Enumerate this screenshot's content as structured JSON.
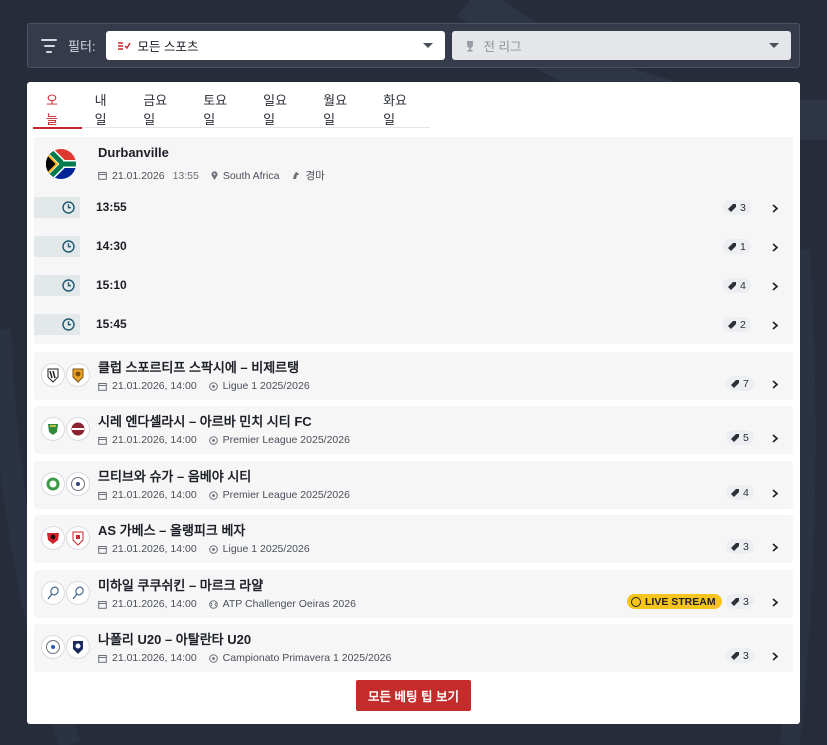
{
  "filter": {
    "label": "필터:",
    "sport_value": "모든 스포츠",
    "league_value": "전 리그"
  },
  "tabs": [
    "오늘",
    "내일",
    "금요일",
    "토요일",
    "일요일",
    "월요일",
    "화요일"
  ],
  "race": {
    "name": "Durbanville",
    "date": "21.01.2026",
    "time": "13:55",
    "country": "South Africa",
    "sport": "경마",
    "rows": [
      {
        "time": "13:55",
        "tips": "3"
      },
      {
        "time": "14:30",
        "tips": "1"
      },
      {
        "time": "15:10",
        "tips": "4"
      },
      {
        "time": "15:45",
        "tips": "2"
      }
    ]
  },
  "matches": [
    {
      "title": "클럽 스포르티프 스팍시에 – 비제르탱",
      "datetime": "21.01.2026, 14:00",
      "league": "Ligue 1 2025/2026",
      "tips": "7",
      "live": false
    },
    {
      "title": "시레 엔다셀라시 – 아르바 민치 시티 FC",
      "datetime": "21.01.2026, 14:00",
      "league": "Premier League 2025/2026",
      "tips": "5",
      "live": false
    },
    {
      "title": "므티브와 슈가 – 음베야 시티",
      "datetime": "21.01.2026, 14:00",
      "league": "Premier League 2025/2026",
      "tips": "4",
      "live": false
    },
    {
      "title": "AS 가베스 – 올랭피크 베자",
      "datetime": "21.01.2026, 14:00",
      "league": "Ligue 1 2025/2026",
      "tips": "3",
      "live": false
    },
    {
      "title": "미하일 쿠쿠쉬킨 – 마르크 라얄",
      "datetime": "21.01.2026, 14:00",
      "league": "ATP Challenger Oeiras 2026",
      "tips": "3",
      "live": true
    },
    {
      "title": "나폴리 U20 – 아탈란타 U20",
      "datetime": "21.01.2026, 14:00",
      "league": "Campionato Primavera 1 2025/2026",
      "tips": "3",
      "live": false
    }
  ],
  "live_label": "LIVE STREAM",
  "cta_label": "모든 베팅 팁 보기",
  "icons": {
    "filter": "filter-icon",
    "sport": "sports-icon",
    "league": "trophy-icon",
    "calendar": "calendar-icon",
    "location": "location-icon",
    "sport_type": "horse-racing-icon",
    "clock": "clock-icon",
    "tip": "tip-icon",
    "chevron": "chevron-right-icon"
  },
  "colors": {
    "accent": "#c8262c",
    "live": "#f6c41c",
    "background": "#262c3a"
  }
}
